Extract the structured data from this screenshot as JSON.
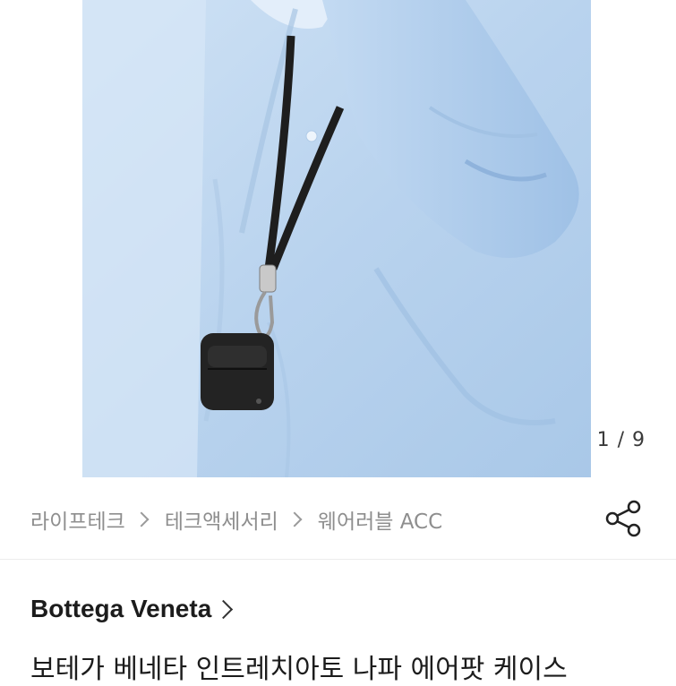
{
  "hero": {
    "counter": "1 / 9",
    "icons": [
      "product-photo"
    ]
  },
  "breadcrumb": {
    "items": [
      "라이프테크",
      "테크액세서리",
      "웨어러블 ACC"
    ]
  },
  "share": {
    "icon": "share-icon"
  },
  "product": {
    "brand": "Bottega Veneta",
    "title": "보테가 베네타 인트레치아토 나파 에어팟 케이스"
  },
  "colors": {
    "shirt": "#bcd6ef",
    "strap": "#1e1e1e",
    "text": "#1c1c1c",
    "muted": "#8e8e8e"
  }
}
